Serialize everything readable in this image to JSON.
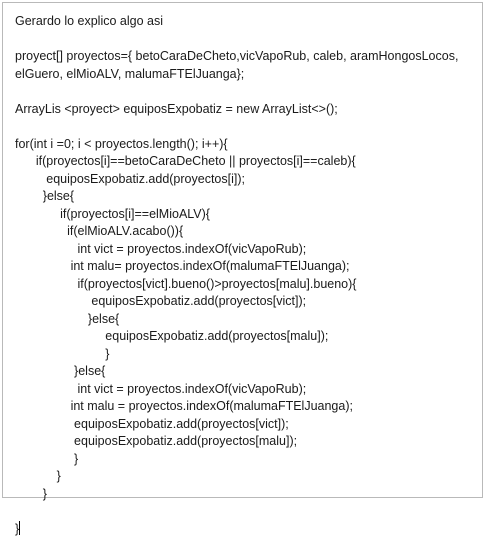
{
  "editor": {
    "lines": [
      "Gerardo lo explico algo asi",
      "",
      "proyect[] proyectos={ betoCaraDeCheto,vicVapoRub, caleb, aramHongosLocos,",
      "elGuero, elMioALV, malumaFTElJuanga};",
      "",
      "ArrayLis <proyect> equiposExpobatiz = new ArrayList<>();",
      "",
      "for(int i =0; i < proyectos.length(); i++){",
      "      if(proyectos[i]==betoCaraDeCheto || proyectos[i]==caleb){",
      "         equiposExpobatiz.add(proyectos[i]);",
      "        }else{",
      "             if(proyectos[i]==elMioALV){",
      "               if(elMioALV.acabo()){",
      "                  int vict = proyectos.indexOf(vicVapoRub);",
      "                int malu= proyectos.indexOf(malumaFTElJuanga);",
      "                  if(proyectos[vict].bueno()>proyectos[malu].bueno){",
      "                      equiposExpobatiz.add(proyectos[vict]);",
      "                     }else{",
      "                          equiposExpobatiz.add(proyectos[malu]);",
      "                          }",
      "                 }else{",
      "                  int vict = proyectos.indexOf(vicVapoRub);",
      "                int malu = proyectos.indexOf(malumaFTElJuanga);",
      "                 equiposExpobatiz.add(proyectos[vict]);",
      "                 equiposExpobatiz.add(proyectos[malu]);",
      "                 }",
      "            }",
      "        }",
      "",
      "}"
    ]
  }
}
